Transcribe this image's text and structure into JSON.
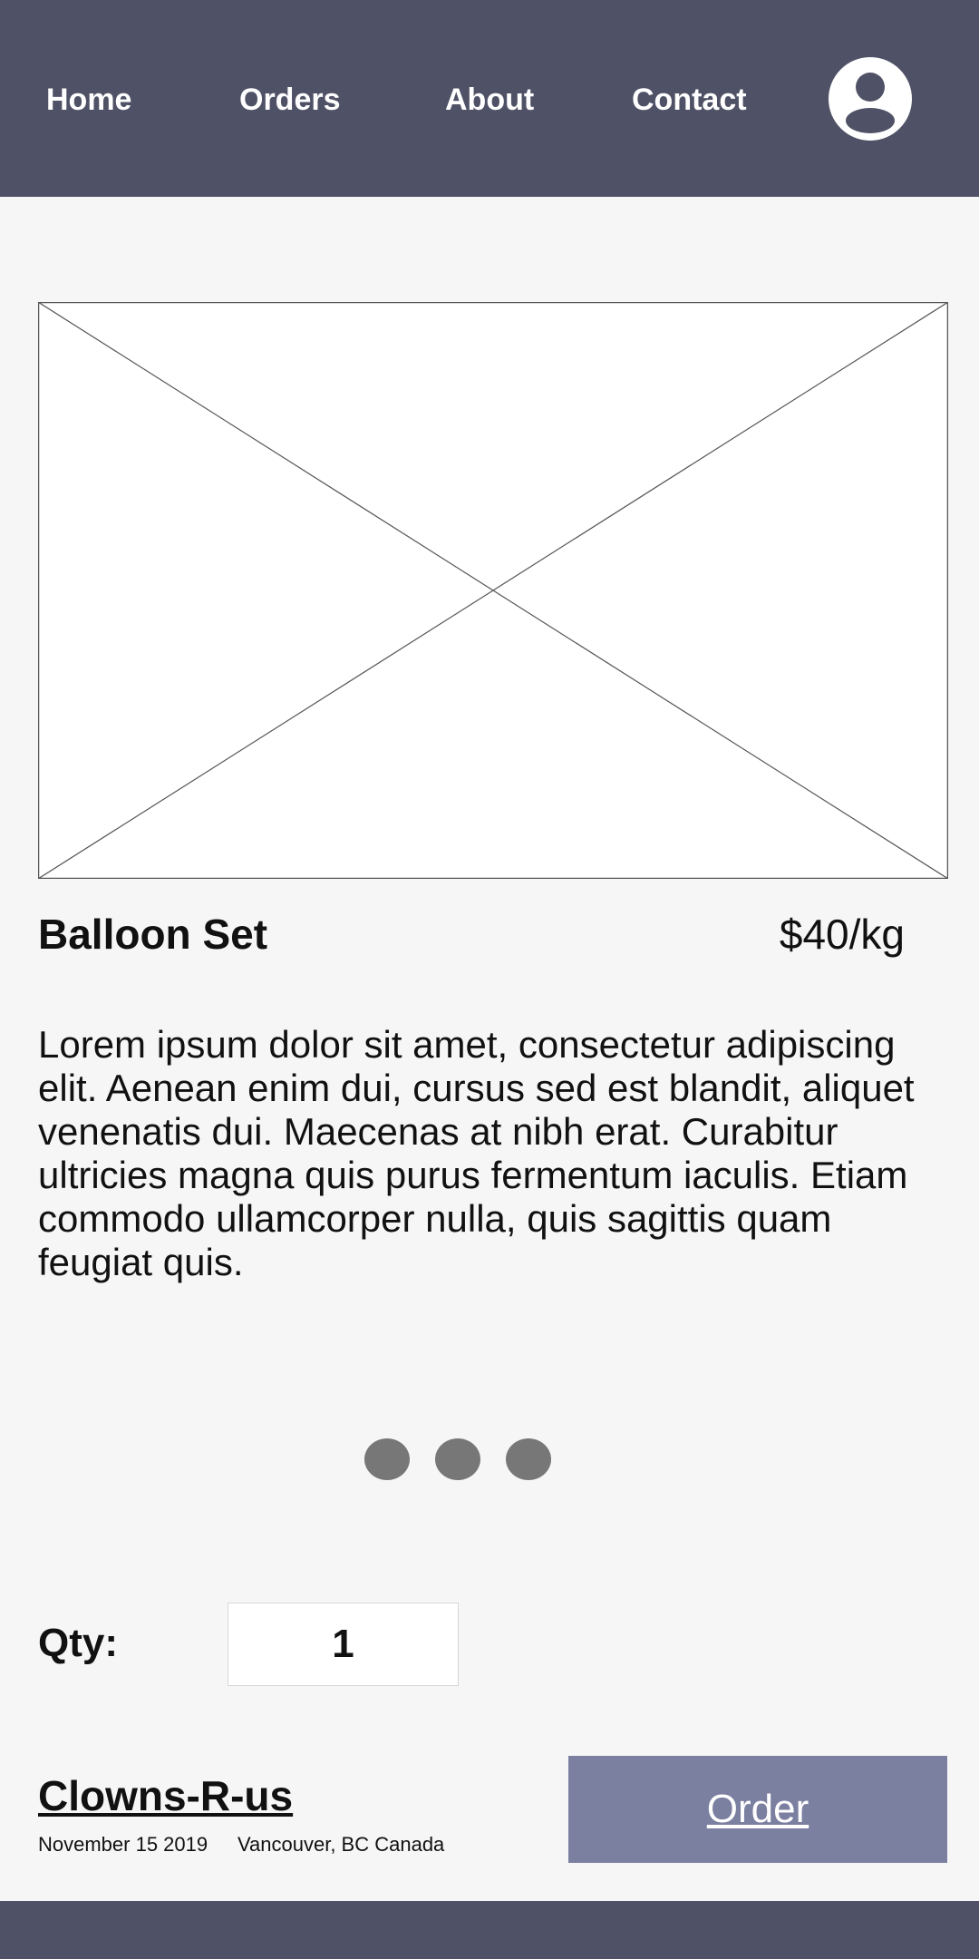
{
  "nav": {
    "items": [
      {
        "label": "Home"
      },
      {
        "label": "Orders"
      },
      {
        "label": "About"
      },
      {
        "label": "Contact"
      }
    ],
    "avatar_icon": "user-avatar-icon"
  },
  "product": {
    "image_icon": "image-placeholder-icon",
    "title": "Balloon Set",
    "price": "$40/kg",
    "description": "Lorem ipsum dolor sit amet, consectetur adipiscing elit. Aenean enim dui, cursus sed est blandit, aliquet venenatis dui. Maecenas at nibh erat. Curabitur ultricies magna quis purus fermentum iaculis. Etiam commodo ullamcorper nulla, quis sagittis quam feugiat quis."
  },
  "carousel": {
    "dot_count": 3
  },
  "quantity": {
    "label": "Qty:",
    "value": "1"
  },
  "footer": {
    "brand": "Clowns-R-us",
    "date": "November 15 2019",
    "location": "Vancouver, BC Canada",
    "order_label": "Order"
  },
  "colors": {
    "nav_background": "#4f5166",
    "page_background": "#f6f6f6",
    "order_button": "#7b7fa0",
    "dot": "#777777"
  }
}
